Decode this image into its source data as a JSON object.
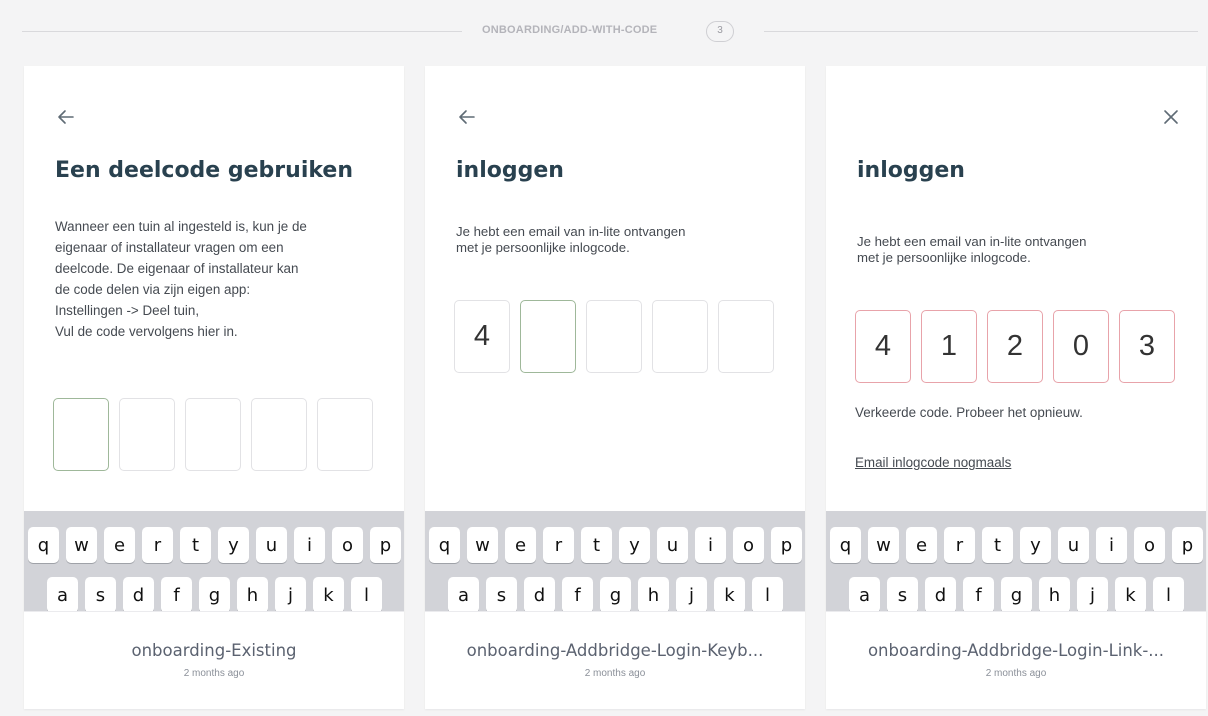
{
  "section": {
    "title": "ONBOARDING/ADD-WITH-CODE",
    "count": "3"
  },
  "keyboard": {
    "row1": [
      "q",
      "w",
      "e",
      "r",
      "t",
      "y",
      "u",
      "i",
      "o",
      "p"
    ],
    "row2": [
      "a",
      "s",
      "d",
      "f",
      "g",
      "h",
      "j",
      "k",
      "l"
    ]
  },
  "cards": [
    {
      "nav_icon": "arrow-left-icon",
      "title": "Een deelcode gebruiken",
      "description": [
        "Wanneer een tuin al ingesteld is, kun je de",
        "eigenaar of installateur vragen om een",
        "deelcode. De eigenaar of installateur kan",
        "de code delen via zijn eigen app:",
        "Instellingen -> Deel tuin,",
        "Vul de code vervolgens hier in."
      ],
      "code": [
        "",
        "",
        "",
        "",
        ""
      ],
      "active_index": 0,
      "footer_name": "onboarding-Existing",
      "footer_date": "2 months ago"
    },
    {
      "nav_icon": "arrow-left-icon",
      "title": "inloggen",
      "description": [
        "Je hebt een email van in-lite ontvangen",
        "met je persoonlijke inlogcode."
      ],
      "code": [
        "4",
        "",
        "",
        "",
        ""
      ],
      "active_index": 1,
      "footer_name": "onboarding-Addbridge-Login-Keyb...",
      "footer_date": "2 months ago"
    },
    {
      "nav_icon": "close-icon",
      "title": "inloggen",
      "description": [
        "Je hebt een email van in-lite ontvangen",
        "met je persoonlijke inlogcode."
      ],
      "code": [
        "4",
        "1",
        "2",
        "0",
        "3"
      ],
      "error_message": "Verkeerde code. Probeer het opnieuw.",
      "resend_link": "Email inlogcode nogmaals",
      "footer_name": "onboarding-Addbridge-Login-Link-...",
      "footer_date": "2 months ago"
    }
  ],
  "colors": {
    "title": "#29414f",
    "active_border": "#9fb89a",
    "error_border": "#e8a3aa",
    "keyboard_bg": "#d2d3d8"
  }
}
